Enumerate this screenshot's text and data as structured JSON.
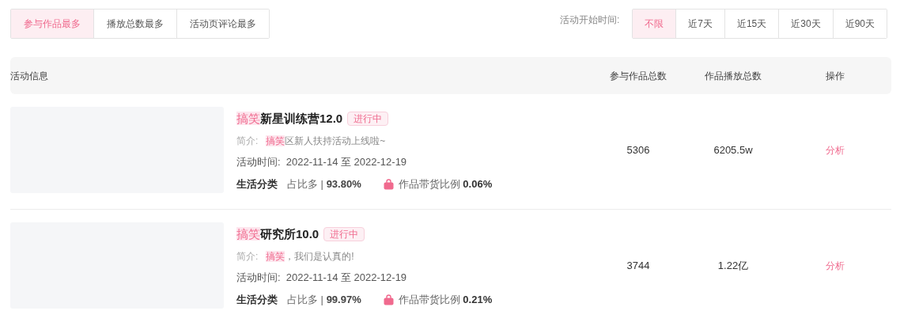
{
  "sort_tabs": [
    {
      "label": "参与作品最多",
      "selected": true
    },
    {
      "label": "播放总数最多",
      "selected": false
    },
    {
      "label": "活动页评论最多",
      "selected": false
    }
  ],
  "time_filter": {
    "label": "活动开始时间:",
    "options": [
      {
        "label": "不限",
        "selected": true
      },
      {
        "label": "近7天",
        "selected": false
      },
      {
        "label": "近15天",
        "selected": false
      },
      {
        "label": "近30天",
        "selected": false
      },
      {
        "label": "近90天",
        "selected": false
      }
    ]
  },
  "table": {
    "columns": [
      "活动信息",
      "参与作品总数",
      "作品播放总数",
      "操作"
    ],
    "rows": [
      {
        "keyword": "搞笑",
        "title": "新星训练营12.0",
        "status": "进行中",
        "intro_label": "简介:",
        "intro_keyword": "搞笑",
        "intro": "区新人扶持活动上线啦~",
        "time": "活动时间:  2022-11-14 至 2022-12-19",
        "category": "生活分类",
        "share_label": "占比多 |",
        "share": "93.80%",
        "goods_label": "作品带货比例",
        "goods": "0.06%",
        "works": "5306",
        "plays": "6205.5w",
        "action": "分析"
      },
      {
        "keyword": "搞笑",
        "title": "研究所10.0",
        "status": "进行中",
        "intro_label": "简介:",
        "intro_keyword": "搞笑",
        "intro": "，我们是认真的!",
        "time": "活动时间:  2022-11-14 至 2022-12-19",
        "category": "生活分类",
        "share_label": "占比多 |",
        "share": "99.97%",
        "goods_label": "作品带货比例",
        "goods": "0.21%",
        "works": "3744",
        "plays": "1.22亿",
        "action": "分析"
      }
    ]
  }
}
